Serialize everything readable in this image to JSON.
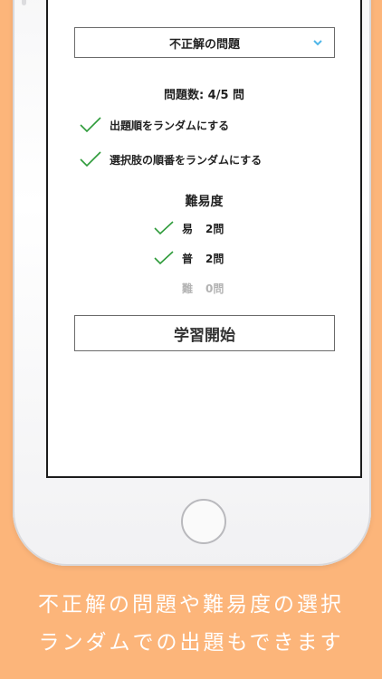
{
  "filter": {
    "selected": "不正解の問題",
    "icon": "chevron-down-icon"
  },
  "question_count": "問題数: 4/5 問",
  "options": [
    {
      "label": "出題順をランダムにする",
      "checked": true
    },
    {
      "label": "選択肢の順番をランダムにする",
      "checked": true
    }
  ],
  "difficulty": {
    "title": "難易度",
    "levels": [
      {
        "name": "易",
        "count": "2問",
        "checked": true
      },
      {
        "name": "普",
        "count": "2問",
        "checked": true
      },
      {
        "name": "難",
        "count": "0問",
        "checked": false
      }
    ]
  },
  "start_button": "学習開始",
  "caption": {
    "line1": "不正解の問題や難易度の選択",
    "line2": "ランダムでの出題もできます"
  },
  "colors": {
    "background": "#fcb57a",
    "check": "#2e9b3a",
    "chevron": "#4fb6e8"
  }
}
